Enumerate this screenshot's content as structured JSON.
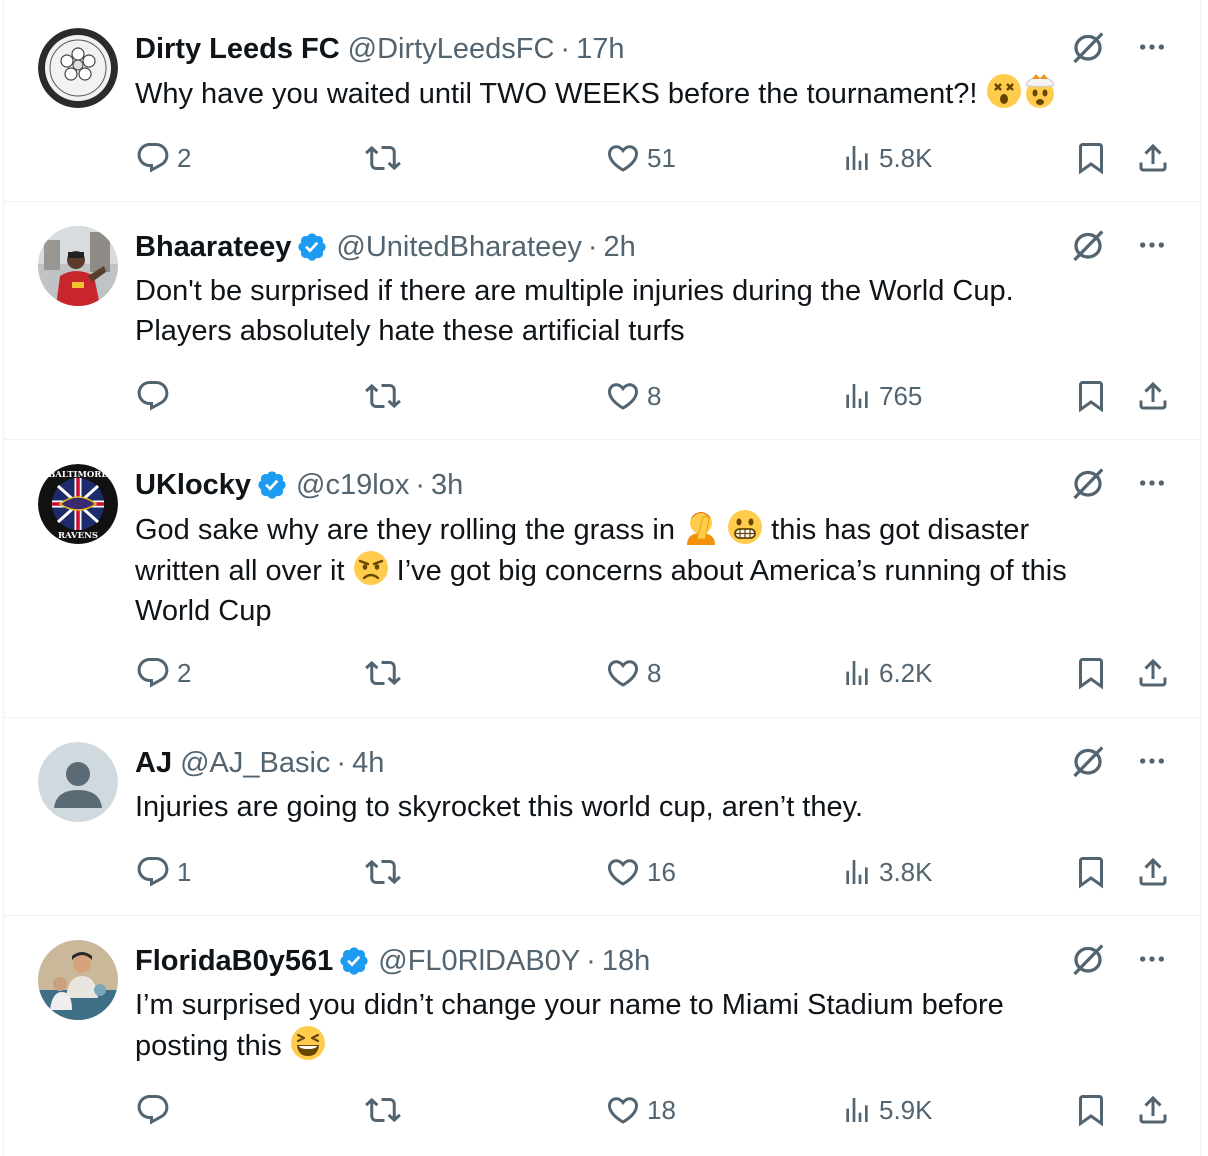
{
  "tweets": [
    {
      "name": "Dirty Leeds FC",
      "verified": false,
      "handle": "@DirtyLeedsFC",
      "time": "17h",
      "text_parts": [
        "Why have you waited until TWO WEEKS before the tournament?! "
      ],
      "emojis": [
        "dizzy-face-emoji",
        "exploding-head-emoji"
      ],
      "replies": "2",
      "retweets": "",
      "likes": "51",
      "views": "5.8K"
    },
    {
      "name": "Bhaarateey",
      "verified": true,
      "handle": "@UnitedBharateey",
      "time": "2h",
      "line1": "Don't be surprised if there are multiple injuries during the World Cup.",
      "line2": "Players absolutely hate these artificial turfs",
      "replies": "",
      "retweets": "",
      "likes": "8",
      "views": "765"
    },
    {
      "name": "UKlocky",
      "verified": true,
      "handle": "@c19lox",
      "time": "3h",
      "line1a": "God sake why are they rolling the grass in ",
      "line1b": " this has got disaster",
      "line2a": "written all over it ",
      "line2b": " I’ve got big concerns about America’s running of this",
      "line3": "World Cup",
      "emojis": [
        "facepalm-emoji",
        "grimacing-face-emoji",
        "angry-face-emoji"
      ],
      "avatar_text_top": "BALTIMORE",
      "avatar_text_bottom": "RAVENS",
      "replies": "2",
      "retweets": "",
      "likes": "8",
      "views": "6.2K"
    },
    {
      "name": "AJ",
      "verified": false,
      "handle": "@AJ_Basic",
      "time": "4h",
      "line1": "Injuries are going to skyrocket this world cup, aren’t they.",
      "replies": "1",
      "retweets": "",
      "likes": "16",
      "views": "3.8K"
    },
    {
      "name": "FloridaB0y561",
      "verified": true,
      "handle": "@FL0RlDAB0Y",
      "time": "18h",
      "line1": "I’m surprised you didn’t change your name to Miami Stadium before",
      "line2": "posting this ",
      "emojis": [
        "squinting-laughing-face-emoji"
      ],
      "replies": "",
      "retweets": "",
      "likes": "18",
      "views": "5.9K"
    }
  ],
  "separator": "·",
  "colors": {
    "text": "#0f1419",
    "secondary": "#536471",
    "verified": "#1d9bf0",
    "border": "#eff3f4"
  }
}
